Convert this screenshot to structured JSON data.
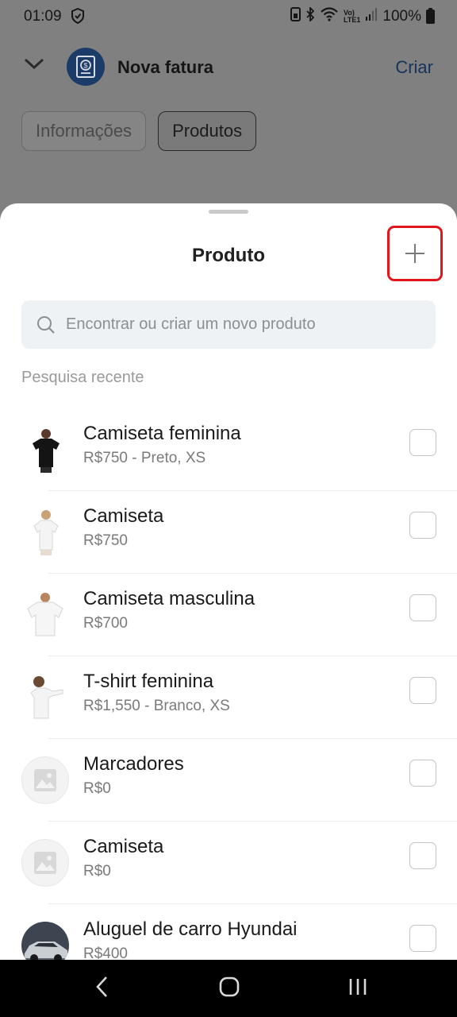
{
  "status_bar": {
    "time": "01:09",
    "battery": "100%"
  },
  "header": {
    "title": "Nova fatura",
    "action_label": "Criar"
  },
  "tabs": [
    {
      "label": "Informações"
    },
    {
      "label": "Produtos"
    }
  ],
  "sheet": {
    "title": "Produto",
    "search_placeholder": "Encontrar ou criar um novo produto",
    "section_label": "Pesquisa recente"
  },
  "products": [
    {
      "name": "Camiseta feminina",
      "detail": "R$750 - Preto, XS",
      "thumb": "black-tshirt-woman"
    },
    {
      "name": "Camiseta",
      "detail": "R$750",
      "thumb": "white-tshirt-woman"
    },
    {
      "name": "Camiseta masculina",
      "detail": "R$700",
      "thumb": "white-tshirt-man"
    },
    {
      "name": "T-shirt feminina",
      "detail": "R$1,550 - Branco, XS",
      "thumb": "white-tshirt-woman-pointing"
    },
    {
      "name": "Marcadores",
      "detail": "R$0",
      "thumb": "image-placeholder"
    },
    {
      "name": "Camiseta",
      "detail": "R$0",
      "thumb": "image-placeholder"
    },
    {
      "name": "Aluguel de carro Hyundai",
      "detail": "R$400",
      "thumb": "silver-car"
    }
  ],
  "colors": {
    "accent": "#16335a",
    "highlight_border": "#e3151c",
    "search_bg": "#eef2f5"
  }
}
